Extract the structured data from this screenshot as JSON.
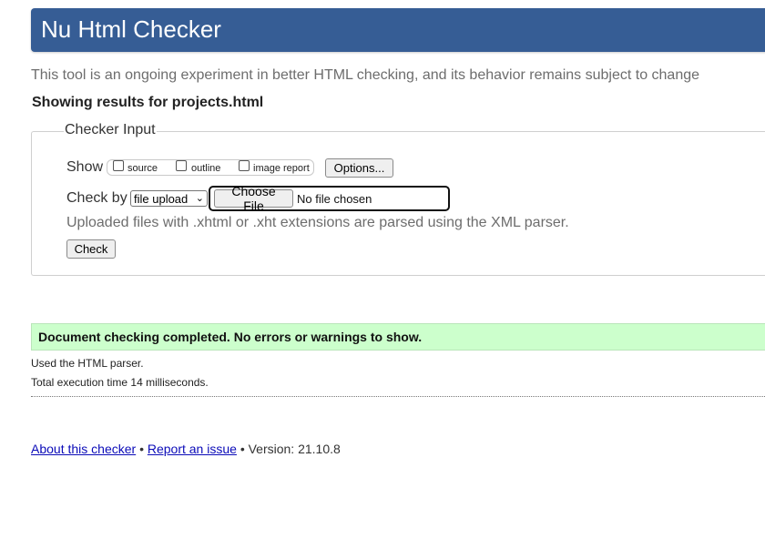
{
  "header": {
    "title": "Nu Html Checker"
  },
  "tagline": "This tool is an ongoing experiment in better HTML checking, and its behavior remains subject to change",
  "results_for": "Showing results for projects.html",
  "checker_input": {
    "legend": "Checker Input",
    "show_label": "Show",
    "show_options": [
      {
        "label": "source",
        "checked": false
      },
      {
        "label": "outline",
        "checked": false
      },
      {
        "label": "image report",
        "checked": false
      }
    ],
    "options_button": "Options...",
    "check_by_label": "Check by",
    "check_by_selected": "file upload",
    "choose_file_button": "Choose File",
    "no_file_text": "No file chosen",
    "hint": "Uploaded files with .xhtml or .xht extensions are parsed using the XML parser.",
    "check_button": "Check"
  },
  "result": {
    "message": "Document checking completed. No errors or warnings to show.",
    "parser_note": "Used the HTML parser.",
    "timing_note": "Total execution time 14 milliseconds."
  },
  "footer": {
    "about_link": "About this checker",
    "separator": "•",
    "report_link": "Report an issue",
    "version": "Version: 21.10.8"
  },
  "colors": {
    "header_bg": "#365d95",
    "success_bg": "#ccffcc",
    "link": "#0b0bb8"
  }
}
